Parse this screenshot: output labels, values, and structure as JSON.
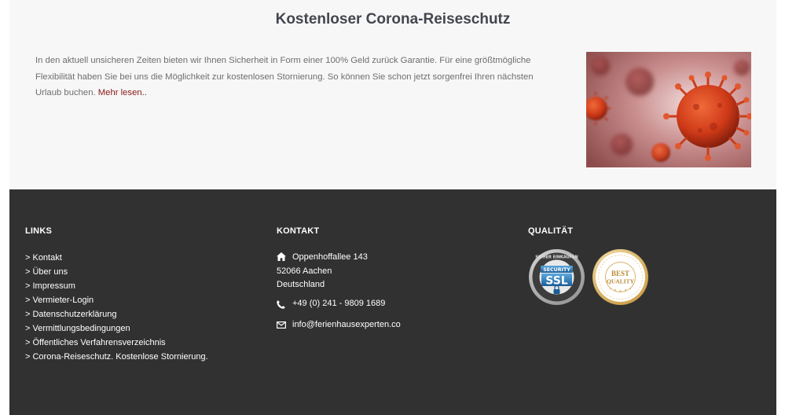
{
  "promo": {
    "title": "Kostenloser Corona-Reiseschutz",
    "text": "In den aktuell unsicheren Zeiten bieten wir Ihnen Sicherheit in Form einer 100% Geld zurück Garantie. Für eine größtmögliche Flexibilität haben Sie bei uns die Möglichkeit zur kostenlosen Stornierung. So können Sie schon jetzt sorgenfrei Ihren nächsten Urlaub buchen. ",
    "more_link": "Mehr lesen..",
    "image_icon": "coronavirus-image"
  },
  "footer": {
    "links": {
      "heading": "LINKS",
      "items": [
        "> Kontakt",
        "> Über uns",
        "> Impressum",
        "> Vermieter-Login",
        "> Datenschutzerklärung",
        "> Vermittlungsbedingungen",
        "> Öffentliches Verfahrensverzeichnis",
        "> Corona-Reiseschutz. Kostenlose Stornierung."
      ]
    },
    "contact": {
      "heading": "KONTAKT",
      "street": "Oppenhoffallee 143",
      "city": "52066 Aachen",
      "country": "Deutschland",
      "phone": "+49 (0) 241 - 9809 1689",
      "email": "info@ferienhausexperten.co",
      "icons": [
        "home-icon",
        "phone-icon",
        "envelope-icon"
      ]
    },
    "quality": {
      "heading": "QUALITÄT",
      "ssl_seal": {
        "ring_text": "SICHER EINKAUFEN",
        "top": "SECURITY",
        "main": "SSL"
      },
      "best_seal": {
        "line1": "BEST",
        "line2": "QUALITY"
      }
    }
  },
  "colors": {
    "footer_bg": "#313131",
    "promo_bg": "#f7f7f7",
    "title": "#44464e",
    "link_red": "#8b1515"
  }
}
